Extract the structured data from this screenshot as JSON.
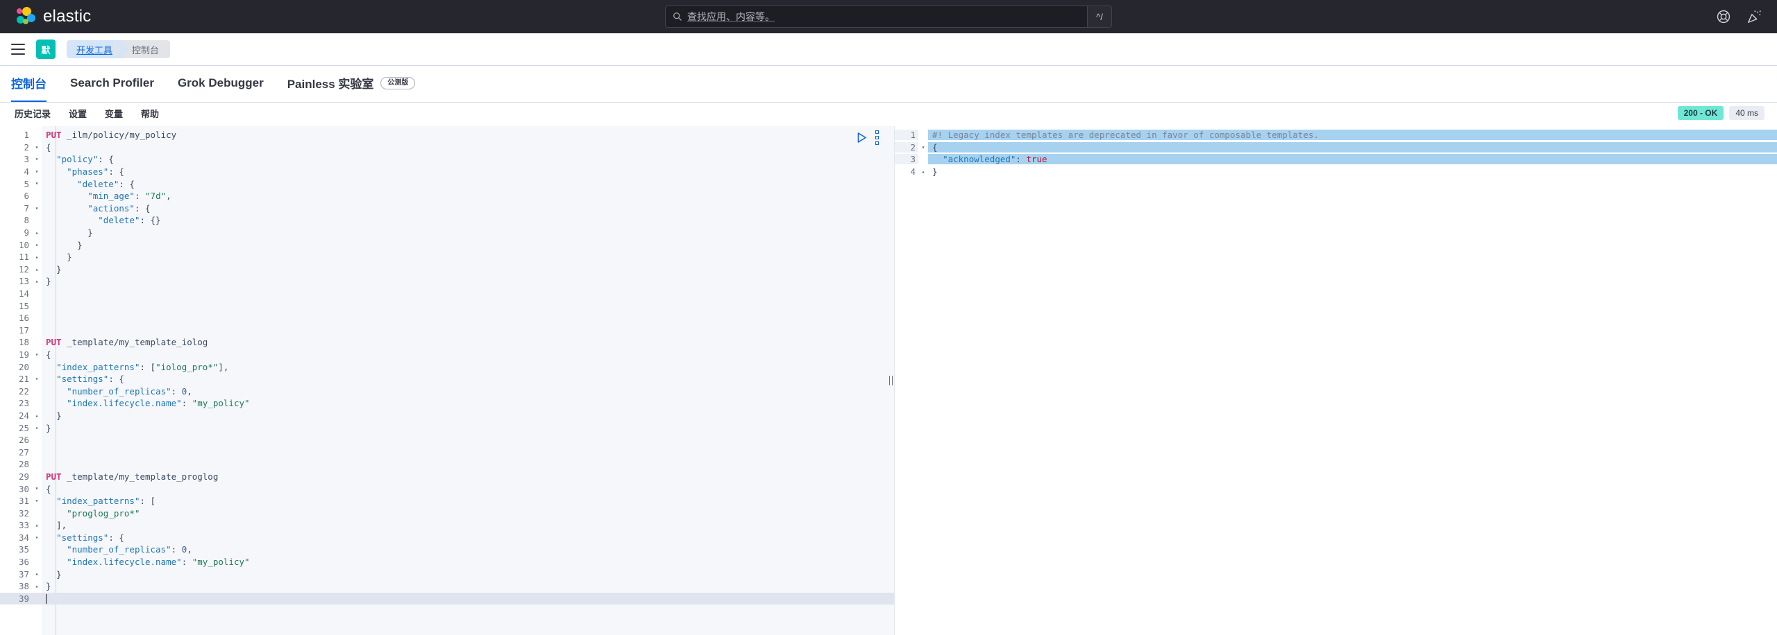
{
  "header": {
    "brand": "elastic",
    "search": {
      "placeholder": "查找应用、内容等。",
      "shortcut": "^/"
    },
    "icons": {
      "help": "help-lifebuoy-icon",
      "news": "party-popper-icon"
    }
  },
  "breadcrumb": {
    "menu_icon": "hamburger-menu-icon",
    "space_initial": "默",
    "items": [
      {
        "label": "开发工具",
        "active": true
      },
      {
        "label": "控制台",
        "active": false
      }
    ]
  },
  "tabs": [
    {
      "label": "控制台",
      "active": true,
      "badge": ""
    },
    {
      "label": "Search Profiler",
      "active": false,
      "badge": ""
    },
    {
      "label": "Grok Debugger",
      "active": false,
      "badge": ""
    },
    {
      "label": "Painless 实验室",
      "active": false,
      "badge": "公测版"
    }
  ],
  "console_menu": [
    "历史记录",
    "设置",
    "变量",
    "帮助"
  ],
  "response_meta": {
    "status": "200 - OK",
    "time": "40 ms",
    "status_color": "#6ee7d5"
  },
  "editor": {
    "action_icons": {
      "send": "play-send-request-icon",
      "more": "wrench-more-actions-icon"
    },
    "cursor_line": 39,
    "lines": [
      {
        "n": 1,
        "fold": "",
        "tokens": [
          {
            "t": "method",
            "v": "PUT"
          },
          {
            "t": "plain",
            "v": " "
          },
          {
            "t": "url",
            "v": "_ilm/policy/my_policy"
          }
        ]
      },
      {
        "n": 2,
        "fold": "▾",
        "tokens": [
          {
            "t": "punct",
            "v": "{"
          }
        ]
      },
      {
        "n": 3,
        "fold": "▾",
        "tokens": [
          {
            "t": "plain",
            "v": "  "
          },
          {
            "t": "key",
            "v": "\"policy\""
          },
          {
            "t": "punct",
            "v": ": {"
          }
        ]
      },
      {
        "n": 4,
        "fold": "▾",
        "tokens": [
          {
            "t": "plain",
            "v": "    "
          },
          {
            "t": "key",
            "v": "\"phases\""
          },
          {
            "t": "punct",
            "v": ": {"
          }
        ]
      },
      {
        "n": 5,
        "fold": "▾",
        "tokens": [
          {
            "t": "plain",
            "v": "      "
          },
          {
            "t": "key",
            "v": "\"delete\""
          },
          {
            "t": "punct",
            "v": ": {"
          }
        ]
      },
      {
        "n": 6,
        "fold": "",
        "tokens": [
          {
            "t": "plain",
            "v": "        "
          },
          {
            "t": "key",
            "v": "\"min_age\""
          },
          {
            "t": "punct",
            "v": ": "
          },
          {
            "t": "str",
            "v": "\"7d\""
          },
          {
            "t": "punct",
            "v": ","
          }
        ]
      },
      {
        "n": 7,
        "fold": "▾",
        "tokens": [
          {
            "t": "plain",
            "v": "        "
          },
          {
            "t": "key",
            "v": "\"actions\""
          },
          {
            "t": "punct",
            "v": ": {"
          }
        ]
      },
      {
        "n": 8,
        "fold": "",
        "tokens": [
          {
            "t": "plain",
            "v": "          "
          },
          {
            "t": "key",
            "v": "\"delete\""
          },
          {
            "t": "punct",
            "v": ": {}"
          }
        ]
      },
      {
        "n": 9,
        "fold": "▴",
        "tokens": [
          {
            "t": "plain",
            "v": "        "
          },
          {
            "t": "punct",
            "v": "}"
          }
        ]
      },
      {
        "n": 10,
        "fold": "▴",
        "tokens": [
          {
            "t": "plain",
            "v": "      "
          },
          {
            "t": "punct",
            "v": "}"
          }
        ]
      },
      {
        "n": 11,
        "fold": "▴",
        "tokens": [
          {
            "t": "plain",
            "v": "    "
          },
          {
            "t": "punct",
            "v": "}"
          }
        ]
      },
      {
        "n": 12,
        "fold": "▴",
        "tokens": [
          {
            "t": "plain",
            "v": "  "
          },
          {
            "t": "punct",
            "v": "}"
          }
        ]
      },
      {
        "n": 13,
        "fold": "▴",
        "tokens": [
          {
            "t": "punct",
            "v": "}"
          }
        ]
      },
      {
        "n": 14,
        "fold": "",
        "tokens": []
      },
      {
        "n": 15,
        "fold": "",
        "tokens": []
      },
      {
        "n": 16,
        "fold": "",
        "tokens": []
      },
      {
        "n": 17,
        "fold": "",
        "tokens": []
      },
      {
        "n": 18,
        "fold": "",
        "tokens": [
          {
            "t": "method",
            "v": "PUT"
          },
          {
            "t": "plain",
            "v": " "
          },
          {
            "t": "url",
            "v": "_template/my_template_iolog"
          }
        ]
      },
      {
        "n": 19,
        "fold": "▾",
        "tokens": [
          {
            "t": "punct",
            "v": "{"
          }
        ]
      },
      {
        "n": 20,
        "fold": "",
        "tokens": [
          {
            "t": "plain",
            "v": "  "
          },
          {
            "t": "key",
            "v": "\"index_patterns\""
          },
          {
            "t": "punct",
            "v": ": ["
          },
          {
            "t": "str",
            "v": "\"iolog_pro*\""
          },
          {
            "t": "punct",
            "v": "],"
          }
        ]
      },
      {
        "n": 21,
        "fold": "▾",
        "tokens": [
          {
            "t": "plain",
            "v": "  "
          },
          {
            "t": "key",
            "v": "\"settings\""
          },
          {
            "t": "punct",
            "v": ": {"
          }
        ]
      },
      {
        "n": 22,
        "fold": "",
        "tokens": [
          {
            "t": "plain",
            "v": "    "
          },
          {
            "t": "key",
            "v": "\"number_of_replicas\""
          },
          {
            "t": "punct",
            "v": ": "
          },
          {
            "t": "num",
            "v": "0"
          },
          {
            "t": "punct",
            "v": ","
          }
        ]
      },
      {
        "n": 23,
        "fold": "",
        "tokens": [
          {
            "t": "plain",
            "v": "    "
          },
          {
            "t": "key",
            "v": "\"index.lifecycle.name\""
          },
          {
            "t": "punct",
            "v": ": "
          },
          {
            "t": "str",
            "v": "\"my_policy\""
          }
        ]
      },
      {
        "n": 24,
        "fold": "▴",
        "tokens": [
          {
            "t": "plain",
            "v": "  "
          },
          {
            "t": "punct",
            "v": "}"
          }
        ]
      },
      {
        "n": 25,
        "fold": "▴",
        "tokens": [
          {
            "t": "punct",
            "v": "}"
          }
        ]
      },
      {
        "n": 26,
        "fold": "",
        "tokens": []
      },
      {
        "n": 27,
        "fold": "",
        "tokens": []
      },
      {
        "n": 28,
        "fold": "",
        "tokens": []
      },
      {
        "n": 29,
        "fold": "",
        "tokens": [
          {
            "t": "method",
            "v": "PUT"
          },
          {
            "t": "plain",
            "v": " "
          },
          {
            "t": "url",
            "v": "_template/my_template_proglog"
          }
        ]
      },
      {
        "n": 30,
        "fold": "▾",
        "tokens": [
          {
            "t": "punct",
            "v": "{"
          }
        ]
      },
      {
        "n": 31,
        "fold": "▾",
        "tokens": [
          {
            "t": "plain",
            "v": "  "
          },
          {
            "t": "key",
            "v": "\"index_patterns\""
          },
          {
            "t": "punct",
            "v": ": ["
          }
        ]
      },
      {
        "n": 32,
        "fold": "",
        "tokens": [
          {
            "t": "plain",
            "v": "    "
          },
          {
            "t": "str",
            "v": "\"proglog_pro*\""
          }
        ]
      },
      {
        "n": 33,
        "fold": "▴",
        "tokens": [
          {
            "t": "plain",
            "v": "  "
          },
          {
            "t": "punct",
            "v": "],"
          }
        ]
      },
      {
        "n": 34,
        "fold": "▾",
        "tokens": [
          {
            "t": "plain",
            "v": "  "
          },
          {
            "t": "key",
            "v": "\"settings\""
          },
          {
            "t": "punct",
            "v": ": {"
          }
        ]
      },
      {
        "n": 35,
        "fold": "",
        "tokens": [
          {
            "t": "plain",
            "v": "    "
          },
          {
            "t": "key",
            "v": "\"number_of_replicas\""
          },
          {
            "t": "punct",
            "v": ": "
          },
          {
            "t": "num",
            "v": "0"
          },
          {
            "t": "punct",
            "v": ","
          }
        ]
      },
      {
        "n": 36,
        "fold": "",
        "tokens": [
          {
            "t": "plain",
            "v": "    "
          },
          {
            "t": "key",
            "v": "\"index.lifecycle.name\""
          },
          {
            "t": "punct",
            "v": ": "
          },
          {
            "t": "str",
            "v": "\"my_policy\""
          }
        ]
      },
      {
        "n": 37,
        "fold": "▴",
        "tokens": [
          {
            "t": "plain",
            "v": "  "
          },
          {
            "t": "punct",
            "v": "}"
          }
        ]
      },
      {
        "n": 38,
        "fold": "▴",
        "tokens": [
          {
            "t": "punct",
            "v": "}"
          }
        ]
      },
      {
        "n": 39,
        "fold": "",
        "tokens": []
      }
    ]
  },
  "output": {
    "lines": [
      {
        "n": 1,
        "fold": "",
        "selected": true,
        "tokens": [
          {
            "t": "comment",
            "v": "#! Legacy index templates are deprecated in favor of composable templates."
          }
        ]
      },
      {
        "n": 2,
        "fold": "▾",
        "selected": true,
        "tokens": [
          {
            "t": "punct",
            "v": "{"
          }
        ]
      },
      {
        "n": 3,
        "fold": "",
        "selected": true,
        "tokens": [
          {
            "t": "plain",
            "v": "  "
          },
          {
            "t": "key",
            "v": "\"acknowledged\""
          },
          {
            "t": "punct",
            "v": ": "
          },
          {
            "t": "bool",
            "v": "true"
          }
        ]
      },
      {
        "n": 4,
        "fold": "▴",
        "selected": false,
        "tokens": [
          {
            "t": "punct",
            "v": "}"
          }
        ]
      }
    ]
  }
}
